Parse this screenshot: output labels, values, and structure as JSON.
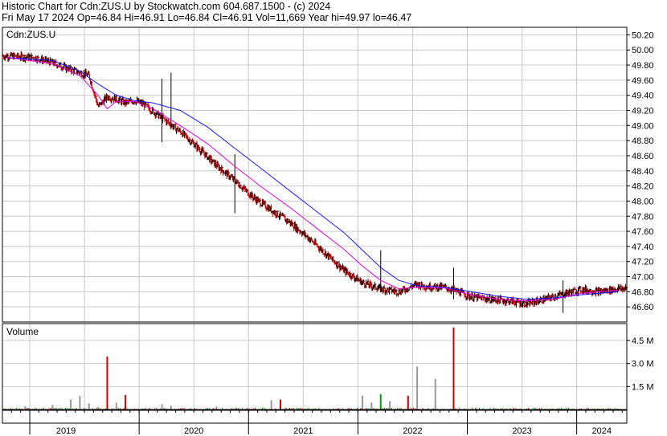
{
  "header": {
    "title": "Historic Chart for Cdn:ZUS.U by Stockwatch.com 604.687.1500 - (c) 2024",
    "stats": "Fri May 17 2024   Op=46.84   Hi=46.91   Lo=46.84   Cl=46.91   Vol=11,669   Year hi=49.97   lo=46.47"
  },
  "colors": {
    "ma_long": "#1a1aff",
    "ma_short": "#e000e0",
    "bar": "#000000",
    "bar_down": "#cc0000",
    "vol_up": "#00a000",
    "vol_down": "#cc0000",
    "vol_flat": "#999999",
    "grid": "#c8c8c8"
  },
  "chart_data": [
    {
      "type": "line",
      "panel_label": "Cdn:ZUS.U",
      "x_labels": [
        "2019",
        "2020",
        "2021",
        "2022",
        "2023",
        "2024"
      ],
      "y_ticks": [
        "50.20",
        "50.00",
        "49.80",
        "49.60",
        "49.40",
        "49.20",
        "49.00",
        "48.80",
        "48.60",
        "48.40",
        "48.20",
        "48.00",
        "47.80",
        "47.60",
        "47.40",
        "47.20",
        "47.00",
        "46.80",
        "46.60"
      ],
      "ylim": [
        46.4,
        50.3
      ],
      "grid": true,
      "series": [
        {
          "name": "",
          "style": "price bars",
          "x": [
            "2018-10",
            "2019-01",
            "2019-03",
            "2019-05",
            "2019-07",
            "2019-08",
            "2019-09",
            "2019-10",
            "2019-11",
            "2019-12",
            "2020-01",
            "2020-03",
            "2020-05",
            "2020-07",
            "2020-09",
            "2020-11",
            "2021-01",
            "2021-03",
            "2021-05",
            "2021-07",
            "2021-09",
            "2021-11",
            "2022-01",
            "2022-03",
            "2022-05",
            "2022-07",
            "2022-08",
            "2022-10",
            "2022-11",
            "2023-01",
            "2023-03",
            "2023-05",
            "2023-07",
            "2023-09",
            "2023-11",
            "2024-01",
            "2024-03",
            "2024-05"
          ],
          "values": [
            49.92,
            49.9,
            49.83,
            49.74,
            49.66,
            49.25,
            49.38,
            49.35,
            49.3,
            49.33,
            49.28,
            49.1,
            48.92,
            48.7,
            48.47,
            48.27,
            48.05,
            47.88,
            47.72,
            47.52,
            47.3,
            47.08,
            46.92,
            46.84,
            46.8,
            46.9,
            46.87,
            46.86,
            46.82,
            46.73,
            46.7,
            46.68,
            46.64,
            46.7,
            46.77,
            46.83,
            46.8,
            46.84
          ]
        },
        {
          "name": "",
          "style": "moving average (long)",
          "x": [
            "2018-10",
            "2019-03",
            "2019-06",
            "2019-08",
            "2019-10",
            "2019-12",
            "2020-02",
            "2020-05",
            "2020-08",
            "2020-11",
            "2021-02",
            "2021-05",
            "2021-08",
            "2021-11",
            "2022-01",
            "2022-03",
            "2022-05",
            "2022-07",
            "2022-10",
            "2023-01",
            "2023-04",
            "2023-07",
            "2023-10",
            "2024-01",
            "2024-05"
          ],
          "values": [
            49.9,
            49.86,
            49.72,
            49.55,
            49.4,
            49.33,
            49.3,
            49.2,
            48.98,
            48.7,
            48.42,
            48.14,
            47.86,
            47.58,
            47.35,
            47.12,
            46.95,
            46.88,
            46.86,
            46.8,
            46.74,
            46.7,
            46.72,
            46.76,
            46.8
          ]
        },
        {
          "name": "",
          "style": "moving average (short)",
          "x": [
            "2018-10",
            "2019-03",
            "2019-06",
            "2019-08",
            "2019-09",
            "2019-10",
            "2019-12",
            "2020-02",
            "2020-05",
            "2020-08",
            "2020-11",
            "2021-02",
            "2021-05",
            "2021-08",
            "2021-11",
            "2022-01",
            "2022-03",
            "2022-05",
            "2022-07",
            "2022-10",
            "2023-01",
            "2023-04",
            "2023-07",
            "2023-10",
            "2024-01",
            "2024-05"
          ],
          "values": [
            49.9,
            49.82,
            49.66,
            49.4,
            49.22,
            49.32,
            49.32,
            49.22,
            49.0,
            48.76,
            48.46,
            48.18,
            47.92,
            47.64,
            47.36,
            47.14,
            46.95,
            46.84,
            46.86,
            46.85,
            46.76,
            46.7,
            46.68,
            46.7,
            46.78,
            46.82
          ]
        }
      ]
    },
    {
      "type": "bar",
      "panel_label": "Volume",
      "y_ticks": [
        "4.5 M",
        "3.0 M",
        "1.5 M"
      ],
      "ylim": [
        0,
        5.6
      ],
      "series": [
        {
          "name": "",
          "unit": "M",
          "x": [
            "2018-12",
            "2019-03",
            "2019-05",
            "2019-06",
            "2019-07",
            "2019-08",
            "2019-09",
            "2019-10",
            "2019-11",
            "2020-03",
            "2020-04",
            "2020-09",
            "2021-03",
            "2021-04",
            "2022-01",
            "2022-02",
            "2022-03",
            "2022-04",
            "2022-06",
            "2022-07",
            "2022-09"
          ],
          "values": [
            0.2,
            0.3,
            0.65,
            0.9,
            0.4,
            0.15,
            3.45,
            0.45,
            0.95,
            0.35,
            0.25,
            0.2,
            0.6,
            0.65,
            0.9,
            0.45,
            1.0,
            0.55,
            0.9,
            2.8,
            2.0
          ],
          "colors": [
            "vol_flat",
            "vol_flat",
            "vol_flat",
            "vol_flat",
            "vol_flat",
            "vol_flat",
            "vol_down",
            "vol_flat",
            "vol_down",
            "vol_flat",
            "vol_flat",
            "vol_flat",
            "vol_flat",
            "vol_down",
            "vol_flat",
            "vol_flat",
            "vol_up",
            "vol_flat",
            "vol_down",
            "vol_flat",
            "vol_flat"
          ]
        },
        {
          "name": "",
          "unit": "M",
          "x": [
            "2022-11"
          ],
          "values": [
            5.35
          ],
          "colors": [
            "vol_down"
          ]
        }
      ]
    }
  ]
}
